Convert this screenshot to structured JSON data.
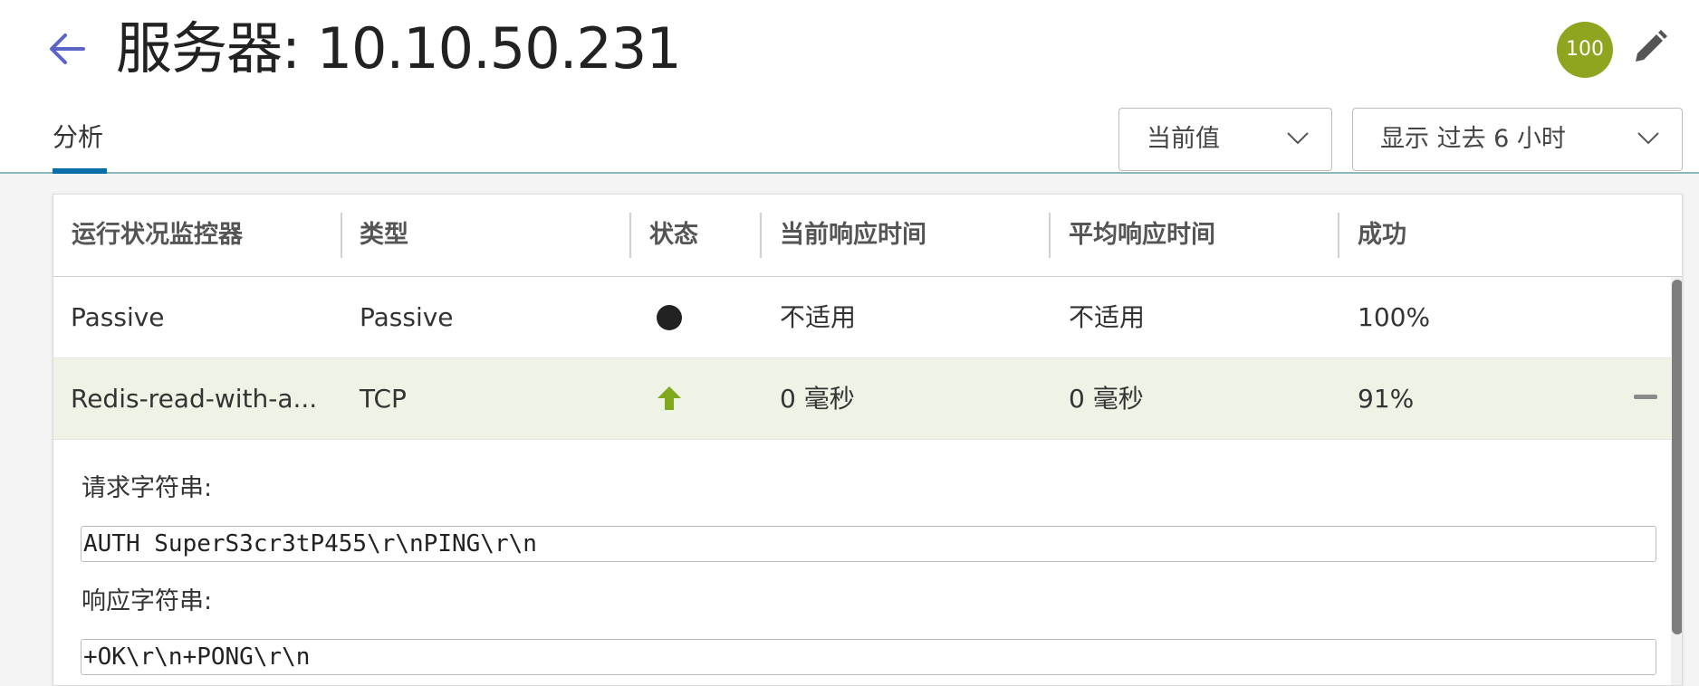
{
  "header": {
    "title": "服务器: 10.10.50.231",
    "score": "100"
  },
  "tabs": [
    {
      "label": "分析",
      "active": true
    }
  ],
  "filters": {
    "value_mode": "当前值",
    "time_range": "显示 过去 6 小时"
  },
  "table": {
    "columns": [
      "运行状况监控器",
      "类型",
      "状态",
      "当前响应时间",
      "平均响应时间",
      "成功"
    ],
    "rows": [
      {
        "monitor": "Passive",
        "type": "Passive",
        "status": "dot-icon",
        "current_response": "不适用",
        "avg_response": "不适用",
        "success": "100%"
      },
      {
        "monitor": "Redis-read-with-a...",
        "type": "TCP",
        "status": "up-arrow-icon",
        "current_response": "0 毫秒",
        "avg_response": "0 毫秒",
        "success": "91%",
        "expanded": true
      }
    ]
  },
  "detail": {
    "request_label": "请求字符串:",
    "request_value": "AUTH SuperS3cr3tP455\\r\\nPING\\r\\n",
    "response_label": "响应字符串:",
    "response_value": "+OK\\r\\n+PONG\\r\\n"
  },
  "colors": {
    "accent": "#5b64c9",
    "badge": "#8fa51f",
    "tab_indicator": "#0a6fa8",
    "status_up": "#7fa81c",
    "expanded_row": "#eef3e6"
  }
}
